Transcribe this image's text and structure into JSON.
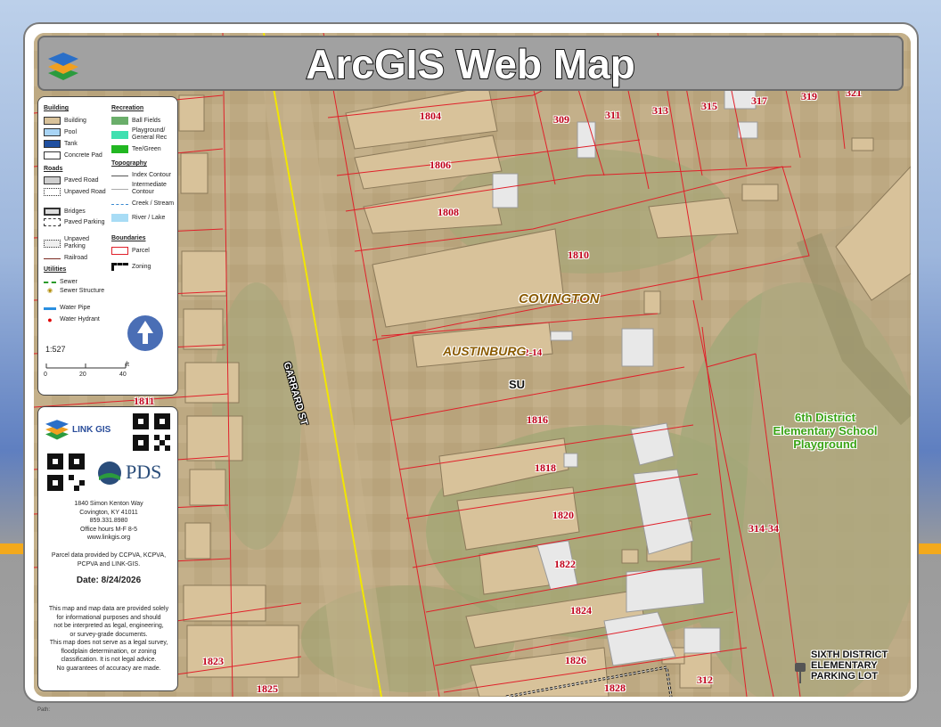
{
  "header": {
    "title": "ArcGIS Web Map"
  },
  "legend": {
    "building_heading": "Building",
    "building_items": [
      "Building",
      "Pool",
      "Tank",
      "Concrete Pad"
    ],
    "roads_heading": "Roads",
    "roads_items": [
      "Paved Road",
      "Unpaved Road",
      "Bridges",
      "Paved Parking",
      "Unpaved Parking",
      "Railroad"
    ],
    "utilities_heading": "Utilities",
    "utilities_items": [
      "Sewer",
      "Sewer Structure",
      "Water Pipe",
      "Water Hydrant"
    ],
    "recreation_heading": "Recreation",
    "recreation_items": [
      "Ball Fields",
      "Playground/ General Rec",
      "Tee/Green"
    ],
    "topography_heading": "Topography",
    "topography_items": [
      "Index Contour",
      "Intermediate Contour",
      "Creek / Stream",
      "River / Lake"
    ],
    "boundaries_heading": "Boundaries",
    "boundaries_items": [
      "Parcel",
      "Zoning"
    ],
    "scale": "1:527",
    "scale_ticks": [
      "0",
      "20",
      "40"
    ],
    "scale_unit": "ft"
  },
  "info": {
    "linkgis_label": "LINK GIS",
    "pds_label": "PDS",
    "address_lines": [
      "1840 Simon Kenton Way",
      "Covington, KY 41011",
      "859.331.8980",
      "Office hours M-F 8-5",
      "www.linkgis.org"
    ],
    "parcel_source_lines": [
      "Parcel data provided by CCPVA, KCPVA,",
      "PCPVA and LINK-GIS."
    ],
    "date": "Date: 8/24/2026",
    "disclaimer_lines": [
      "This map and map data are provided solely",
      "for informational purposes and should",
      "not be interpreted as legal, engineering,",
      "or survey-grade documents.",
      "This map does not serve as a legal survey,",
      "floodplain determination, or zoning",
      "classification. It is not legal advice.",
      "No guarantees of accuracy are made."
    ]
  },
  "map": {
    "street_label": "GARRARD ST",
    "place_labels": [
      "COVINGTON",
      "AUSTINBURG"
    ],
    "zoning_label": "SU",
    "school_label_lines": [
      "6th District",
      "Elementary School",
      "Playground"
    ],
    "parking_label_lines": [
      "SIXTH DISTRICT",
      "ELEMENTARY",
      "PARKING LOT"
    ],
    "parcel_labels": [
      "1804",
      "309",
      "311",
      "313",
      "315",
      "317",
      "319",
      "321",
      "1806",
      "1808",
      "1810",
      "2-14",
      "1816",
      "1818",
      "1820",
      "1822",
      "1824",
      "1826",
      "1828",
      "312",
      "314-34",
      "1811",
      "1823",
      "1825"
    ]
  },
  "footer": {
    "path_label": "Path:"
  },
  "colors": {
    "building": "#d8c29a",
    "pool": "#a8d4f5",
    "tank": "#1f4fa0",
    "parcel_line": "#e0202a",
    "road_line": "#f2e600",
    "ball_fields": "#6aae6a",
    "playground": "#3fe0b0",
    "tee_green": "#22b722",
    "water_pipe": "#2a8fe0",
    "hydrant": "#e00000",
    "sewer": "#2a9a2a"
  }
}
